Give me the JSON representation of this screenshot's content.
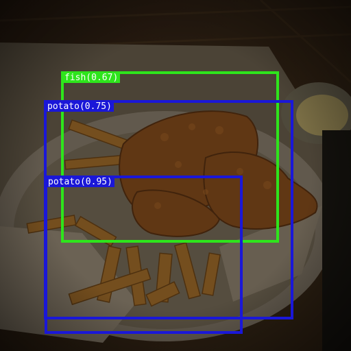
{
  "image": {
    "subject": "fish-and-chips",
    "colors": {
      "fish_box": "#2ee51c",
      "potato_box": "#1a17d8",
      "label_text": "#ffffff"
    }
  },
  "detections": [
    {
      "label": "fish(0.67)"
    },
    {
      "label": "potato(0.75)"
    },
    {
      "label": "potato(0.95)"
    }
  ]
}
